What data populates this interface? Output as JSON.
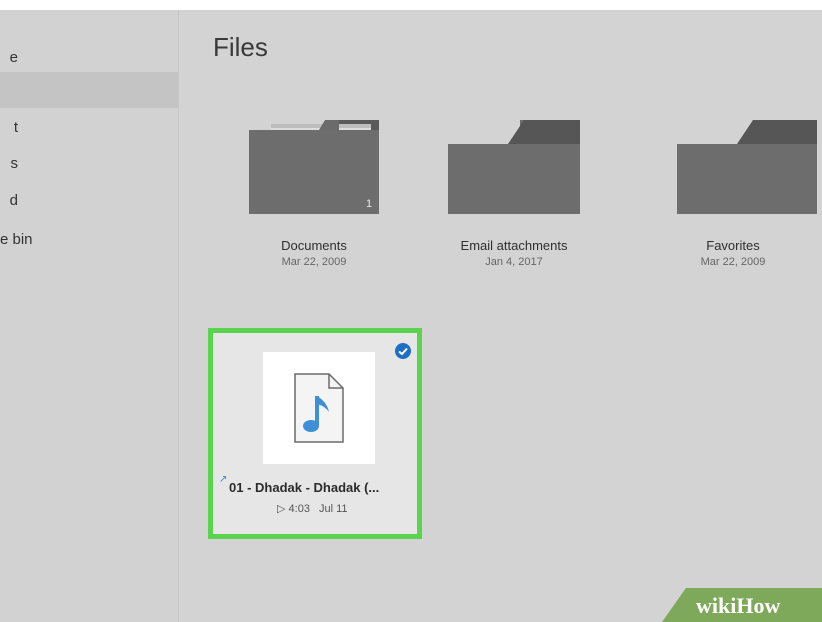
{
  "sidebar": {
    "items": [
      {
        "label": "e"
      },
      {
        "label": ""
      },
      {
        "label": "t"
      },
      {
        "label": "s"
      },
      {
        "label": "d"
      },
      {
        "label": "e bin"
      }
    ]
  },
  "main": {
    "title": "Files",
    "folders": [
      {
        "name": "Documents",
        "date": "Mar 22, 2009",
        "count": "1"
      },
      {
        "name": "Email attachments",
        "date": "Jan 4, 2017"
      },
      {
        "name": "Favorites",
        "date": "Mar 22, 2009"
      }
    ],
    "files": [
      {
        "name": "01 - Dhadak - Dhadak (...",
        "duration": "4:03",
        "date": "Jul 11",
        "selected": true
      }
    ]
  },
  "watermark": {
    "text": "wikiHow"
  },
  "colors": {
    "background": "#d3d3d3",
    "selection_border": "#5ad44f",
    "check": "#1e6fc5",
    "folder": "#6b6b6b"
  },
  "icons": [
    "folder-icon",
    "music-file-icon",
    "checkmark-icon",
    "play-icon",
    "sync-icon"
  ]
}
